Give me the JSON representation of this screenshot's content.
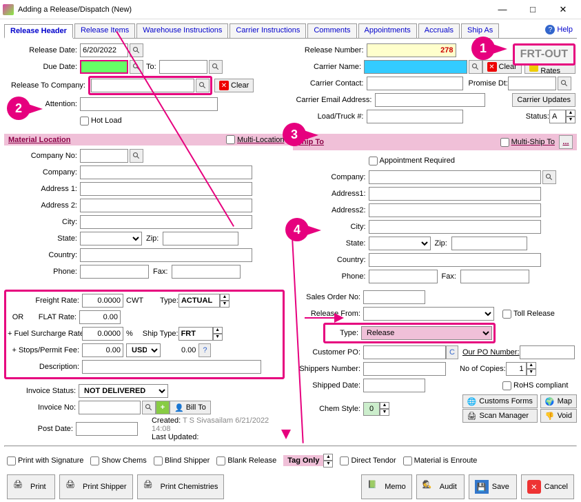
{
  "window": {
    "title": "Adding a Release/Dispatch  (New)"
  },
  "tabs": [
    "Release Header",
    "Release Items",
    "Warehouse Instructions",
    "Carrier Instructions",
    "Comments",
    "Appointments",
    "Accruals",
    "Ship As"
  ],
  "help": "Help",
  "frt_out": "FRT-OUT",
  "left": {
    "release_date_lbl": "Release Date:",
    "release_date": "6/20/2022",
    "due_date_lbl": "Due Date:",
    "to_lbl": "To:",
    "release_to_company_lbl": "Release To Company:",
    "clear": "Clear",
    "attention_lbl": "Attention:",
    "hot_load": "Hot Load"
  },
  "right_top": {
    "release_number_lbl": "Release Number:",
    "release_number": "278",
    "carrier_name_lbl": "Carrier Name:",
    "clear": "Clear",
    "frt_rates": "Frt Rates",
    "carrier_contact_lbl": "Carrier Contact:",
    "promise_dt_lbl": "Promise Dt:",
    "carrier_email_lbl": "Carrier Email Address:",
    "carrier_updates": "Carrier Updates",
    "load_truck_lbl": "Load/Truck #:",
    "status_lbl": "Status:",
    "status_value": "A"
  },
  "mat_loc": {
    "header": "Material Location",
    "multi_loc": "Multi-Location",
    "company_no": "Company No:",
    "company": "Company:",
    "address1": "Address 1:",
    "address2": "Address 2:",
    "city": "City:",
    "state": "State:",
    "zip": "Zip:",
    "country": "Country:",
    "phone": "Phone:",
    "fax": "Fax:"
  },
  "ship_to": {
    "header": "Ship To",
    "multi_ship": "Multi-Ship To",
    "appt_req": "Appointment Required",
    "company": "Company:",
    "address1": "Address1:",
    "address2": "Address2:",
    "city": "City:",
    "state": "State:",
    "zip": "Zip:",
    "country": "Country:",
    "phone": "Phone:",
    "fax": "Fax:"
  },
  "freight": {
    "freight_rate_lbl": "Freight Rate:",
    "freight_rate": "0.0000",
    "cwt": "CWT",
    "type_lbl": "Type:",
    "type_val": "ACTUAL",
    "or": "OR",
    "flat_rate_lbl": "FLAT Rate:",
    "flat_rate": "0.00",
    "fuel_lbl": "+ Fuel Surcharge Rate:",
    "fuel_val": "0.0000",
    "pct": "%",
    "ship_type_lbl": "Ship Type:",
    "ship_type": "FRT",
    "stops_lbl": "+ Stops/Permit Fee:",
    "stops_val": "0.00",
    "usd": "USD",
    "zero": "0.00",
    "q": "?",
    "desc_lbl": "Description:"
  },
  "invoice": {
    "status_lbl": "Invoice Status:",
    "status_val": "NOT DELIVERED",
    "invoice_no_lbl": "Invoice No:",
    "bill_to": "Bill To",
    "post_date_lbl": "Post Date:",
    "created_lbl": "Created:",
    "created_by": "T S Sivasailam 6/21/2022 14:08",
    "last_updated_lbl": "Last Updated:"
  },
  "right_mid": {
    "sales_order_lbl": "Sales Order No:",
    "release_from_lbl": "Release From:",
    "toll_release": "Toll Release",
    "type_lbl": "Type:",
    "type_val": "Release",
    "customer_po_lbl": "Customer PO:",
    "c_btn": "C",
    "our_po_lbl": "Our PO Number:",
    "shippers_no_lbl": "Shippers Number:",
    "no_copies_lbl": "No of Copies:",
    "no_copies": "1",
    "shipped_date_lbl": "Shipped Date:",
    "rohs": "RoHS compliant",
    "chem_style_lbl": "Chem Style:",
    "chem_style": "0"
  },
  "side_btns": {
    "customs": "Customs Forms",
    "scan": "Scan Manager",
    "map": "Map",
    "void": "Void"
  },
  "bottom_checks": {
    "print_sig": "Print with Signature",
    "show_chems": "Show Chems",
    "blind_shipper": "Blind Shipper",
    "blank_release": "Blank Release",
    "tag_only": "Tag Only",
    "direct_tendor": "Direct Tendor",
    "material_enroute": "Material is Enroute"
  },
  "bottom_btns": {
    "print": "Print",
    "print_shipper": "Print Shipper",
    "print_chem": "Print Chemistries",
    "memo": "Memo",
    "audit": "Audit",
    "save": "Save",
    "cancel": "Cancel"
  }
}
